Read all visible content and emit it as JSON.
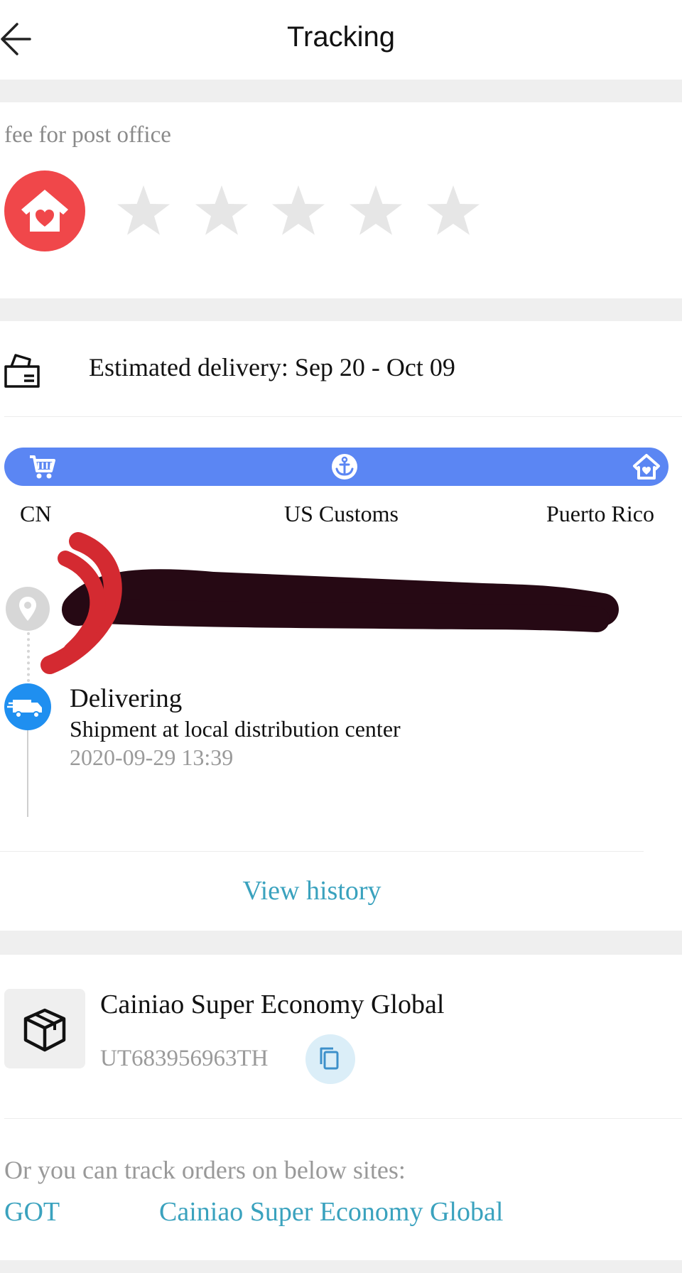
{
  "header": {
    "title": "Tracking",
    "back_icon": "arrow-left-icon"
  },
  "rating": {
    "label": "fee for post office",
    "badge_icon": "house-heart-icon",
    "star_icon": "star-icon",
    "stars_total": 5,
    "stars_selected": 0
  },
  "delivery": {
    "icon": "truck-outline-icon",
    "estimate": "Estimated delivery: Sep 20 - Oct 09"
  },
  "route": {
    "bar_color": "#5b86f3",
    "stops": [
      {
        "label": "CN",
        "icon": "cart-icon"
      },
      {
        "label": "US Customs",
        "icon": "anchor-icon"
      },
      {
        "label": "Puerto Rico",
        "icon": "house-icon"
      }
    ]
  },
  "timeline": {
    "destination_icon": "location-pin-icon",
    "event": {
      "icon": "delivery-truck-icon",
      "status": "Delivering",
      "description": "Shipment at local distribution center",
      "time": "2020-09-29 13:39"
    }
  },
  "view_history": "View history",
  "carrier": {
    "icon": "package-box-icon",
    "name": "Cainiao Super Economy Global",
    "tracking_number": "UT683956963TH",
    "copy_icon": "copy-icon"
  },
  "alternatives": {
    "label": "Or you can track orders on below sites:",
    "links": [
      "GOT",
      "Cainiao Super Economy Global"
    ]
  },
  "colors": {
    "accent_blue": "#1f8ff0",
    "link": "#3aa2be",
    "badge_red": "#f0474a"
  }
}
